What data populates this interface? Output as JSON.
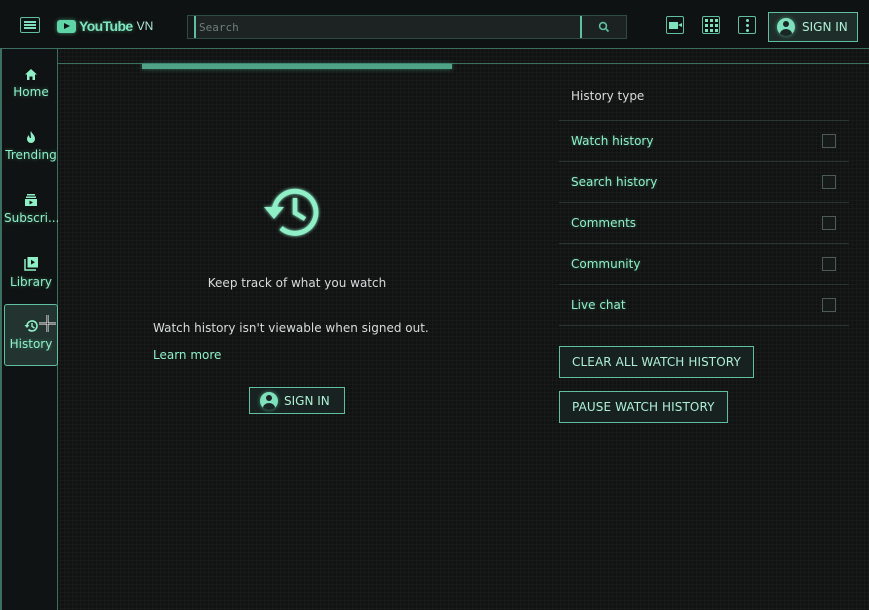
{
  "app": {
    "logo_text": "YouTube",
    "region": "VN"
  },
  "header": {
    "search_placeholder": "Search",
    "signin_label": "SIGN IN",
    "icons": [
      "menu-icon",
      "search-icon",
      "video-camera-icon",
      "apps-grid-icon",
      "more-vert-icon",
      "account-circle-icon"
    ]
  },
  "sidebar": {
    "items": [
      {
        "label": "Home",
        "icon": "home-icon"
      },
      {
        "label": "Trending",
        "icon": "flame-icon"
      },
      {
        "label": "Subscri...",
        "icon": "subscriptions-icon"
      },
      {
        "label": "Library",
        "icon": "library-icon"
      },
      {
        "label": "History",
        "icon": "history-icon",
        "active": true
      }
    ]
  },
  "main": {
    "heading": "Keep track of what you watch",
    "message": "Watch history isn't viewable when signed out.",
    "learn_more": "Learn more",
    "signin_label": "SIGN IN"
  },
  "history_panel": {
    "title": "History type",
    "options": [
      {
        "label": "Watch history",
        "checked": false
      },
      {
        "label": "Search history",
        "checked": false
      },
      {
        "label": "Comments",
        "checked": false
      },
      {
        "label": "Community",
        "checked": false
      },
      {
        "label": "Live chat",
        "checked": false
      }
    ],
    "clear_button": "CLEAR ALL WATCH HISTORY",
    "pause_button": "PAUSE WATCH HISTORY"
  },
  "colors": {
    "accent": "#5fbf9f",
    "accent_text": "#8ff0c8",
    "background": "#111313"
  }
}
